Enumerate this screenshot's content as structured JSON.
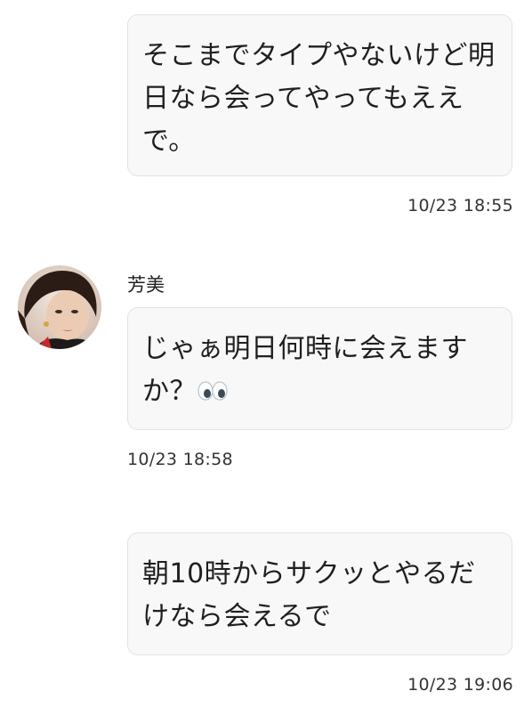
{
  "messages": [
    {
      "side": "right",
      "text": "そこまでタイプやないけど明日なら会ってやってもええで。",
      "time": "10/23 18:55"
    },
    {
      "side": "left",
      "sender": "芳美",
      "avatar_icon": "user-photo-avatar",
      "text": "じゃぁ明日何時に会えますか？",
      "emoji": "eyes-emoji",
      "time": "10/23 18:58"
    },
    {
      "side": "right",
      "text": "朝10時からサクッとやるだけなら会えるで",
      "time": "10/23 19:06"
    }
  ]
}
